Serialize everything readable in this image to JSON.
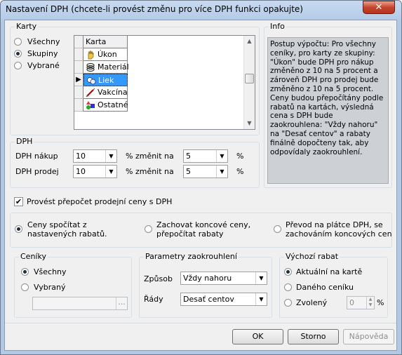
{
  "window": {
    "title": "Nastavení DPH (chcete-li provést změnu pro více DPH funkci opakujte)",
    "close_label": "✕"
  },
  "karty": {
    "label": "Karty",
    "options": [
      "Všechny",
      "Skupiny",
      "Vybrané"
    ],
    "selected": "Skupiny",
    "grid": {
      "header": "Karta",
      "rows": [
        {
          "label": "Úkon",
          "icon": "hand-icon"
        },
        {
          "label": "Materiál",
          "icon": "coil-icon"
        },
        {
          "label": "Liek",
          "icon": "pills-icon",
          "selected": true
        },
        {
          "label": "Vakcína",
          "icon": "syringe-icon"
        },
        {
          "label": "Ostatné",
          "icon": "shapes-icon"
        }
      ],
      "current_row_marker": "▶"
    }
  },
  "info": {
    "label": "Info",
    "text": "Postup výpočtu: Pro všechny ceníky, pro karty ze skupiny: \"Úkon\" bude DPH pro nákup změněno z 10 na 5 procent a zároveň DPH pro prodej bude změněno z 10 na 5 procent. Ceny budou přepočítány podle rabatů na kartách, výsledná cena s DPH bude zaokrouhlena: \"Vždy nahoru\" na \"Desať centov\" a rabaty finálně dopočteny tak, aby odpovídaly zaokrouhlení."
  },
  "dph": {
    "label": "DPH",
    "nakup_label": "DPH nákup",
    "prodej_label": "DPH prodej",
    "nakup_from": "10",
    "nakup_to": "5",
    "prodej_from": "10",
    "prodej_to": "5",
    "zmenit_label": "% změnit na",
    "percent": "%"
  },
  "recalc": {
    "checkbox_label": "Provést přepočet prodejní ceny s DPH",
    "checked": true,
    "options": [
      {
        "line1": "Ceny spočítat z",
        "line2": "nastavených rabatů.",
        "checked": true
      },
      {
        "line1": "Zachovat koncové ceny,",
        "line2": "přepočítat rabaty",
        "checked": false
      },
      {
        "line1": "Převod na plátce DPH, se",
        "line2": "zachováním koncových cen",
        "checked": false
      }
    ]
  },
  "ceniky": {
    "label": "Ceníky",
    "options": [
      "Všechny",
      "Vybraný"
    ],
    "selected": "Všechny",
    "ellipsis": "..."
  },
  "zaokrouhleni": {
    "label": "Parametry zaokrouhlení",
    "zpusob_label": "Způsob",
    "zpusob_value": "Vždy nahoru",
    "rady_label": "Řády",
    "rady_value": "Desať centov"
  },
  "rabat": {
    "label": "Výchozí rabat",
    "options": [
      "Aktuální na kartě",
      "Daného ceníku",
      "Zvolený"
    ],
    "selected": "Aktuální na kartě",
    "zvoleny_value": "0",
    "percent": "%"
  },
  "buttons": {
    "ok": "OK",
    "storno": "Storno",
    "napoveda": "Nápověda"
  }
}
